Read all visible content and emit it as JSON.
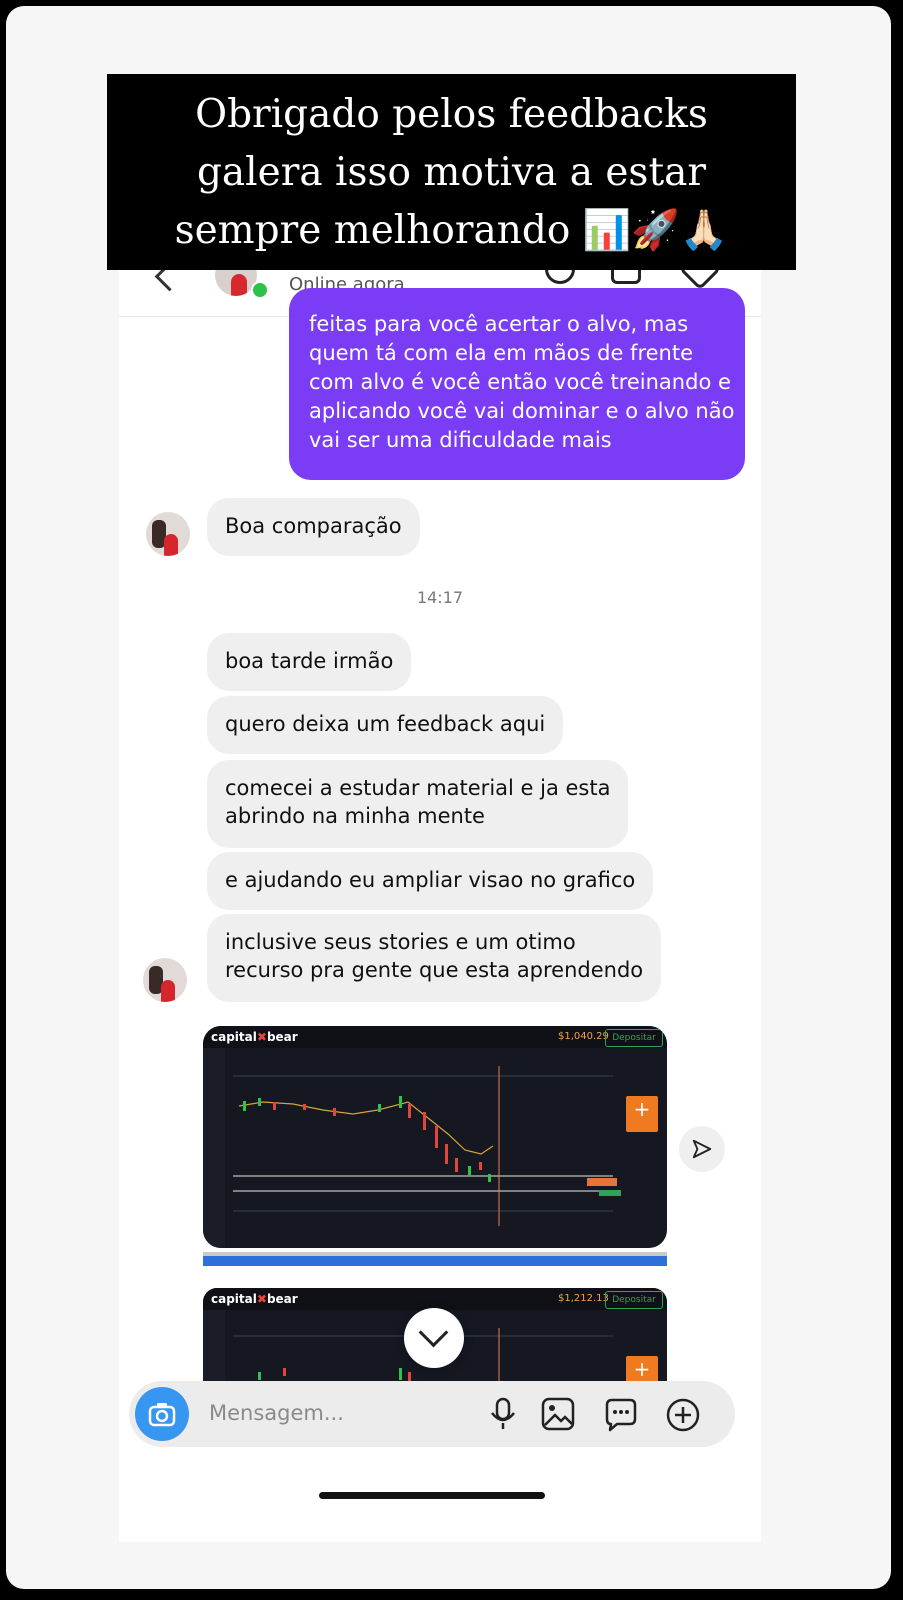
{
  "caption": {
    "line1": "Obrigado pelos feedbacks",
    "line2": "galera isso motiva a estar",
    "line3": "sempre melhorando 📊🚀🙏🏻"
  },
  "header": {
    "status": "Online agora"
  },
  "sent_message": {
    "lines": [
      "feitas para você acertar o alvo, mas",
      "quem tá com ela em mãos de frente",
      "com alvo é você então você treinando e",
      "aplicando você vai dominar e o alvo não",
      "vai ser uma dificuldade mais"
    ]
  },
  "messages": {
    "m1": "Boa comparação",
    "time": "14:17",
    "m2": "boa tarde irmão",
    "m3": "quero deixa um feedback aqui",
    "m4a": "comecei a estudar material e ja esta",
    "m4b": "abrindo na minha mente",
    "m5": "e ajudando eu ampliar visao no grafico",
    "m6a": "inclusive seus stories e um otimo",
    "m6b": "recurso pra gente que esta aprendendo"
  },
  "screenshot": {
    "brand_a": "capital",
    "brand_b": "bear",
    "balance": "$1,040.29",
    "deposit": "Depositar",
    "balance2": "$1,212.13",
    "plus": "+"
  },
  "composer": {
    "placeholder": "Mensagem..."
  },
  "colors": {
    "sent_bubble": "#7a3cf5",
    "received_bubble": "#efefef",
    "camera_button": "#3797f0",
    "online_dot": "#2ec24d"
  }
}
